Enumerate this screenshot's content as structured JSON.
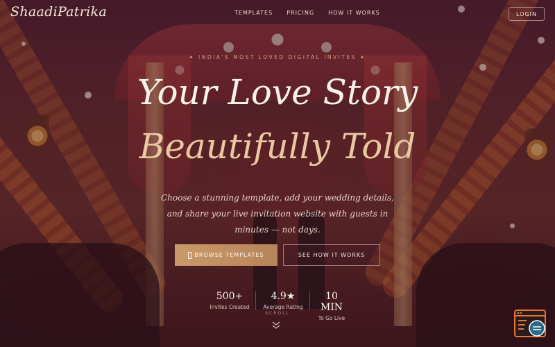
{
  "nav": {
    "logo": "ShaadiPatrika",
    "links": [
      "TEMPLATES",
      "PRICING",
      "HOW IT WORKS"
    ],
    "login": "LOGIN"
  },
  "hero": {
    "eyebrow": "✦ INDIA'S MOST LOVED DIGITAL INVITES ✦",
    "title_line1": "Your Love Story",
    "title_line2": "Beautifully Told",
    "subtitle": "Choose a stunning template, add your wedding details, and share your live invitation website with guests in minutes — not days.",
    "primary_cta": "BROWSE TEMPLATES",
    "secondary_cta": "SEE HOW IT WORKS",
    "scroll_label": "SCROLL"
  },
  "stats": [
    {
      "value": "500+",
      "label": "Invites Created"
    },
    {
      "value": "4.9★",
      "label": "Average Rating"
    },
    {
      "value": "10 MIN",
      "label": "To Go Live"
    }
  ],
  "colors": {
    "accent_gold": "#c99a6a",
    "title_cream": "#fbf3ea",
    "title_gold": "#e9c8a2",
    "background": "#3a1620"
  },
  "icons": {
    "primary_cta_icon": "template-icon",
    "scroll": "chevron-down-icon",
    "widget": "chat-widget-icon"
  }
}
